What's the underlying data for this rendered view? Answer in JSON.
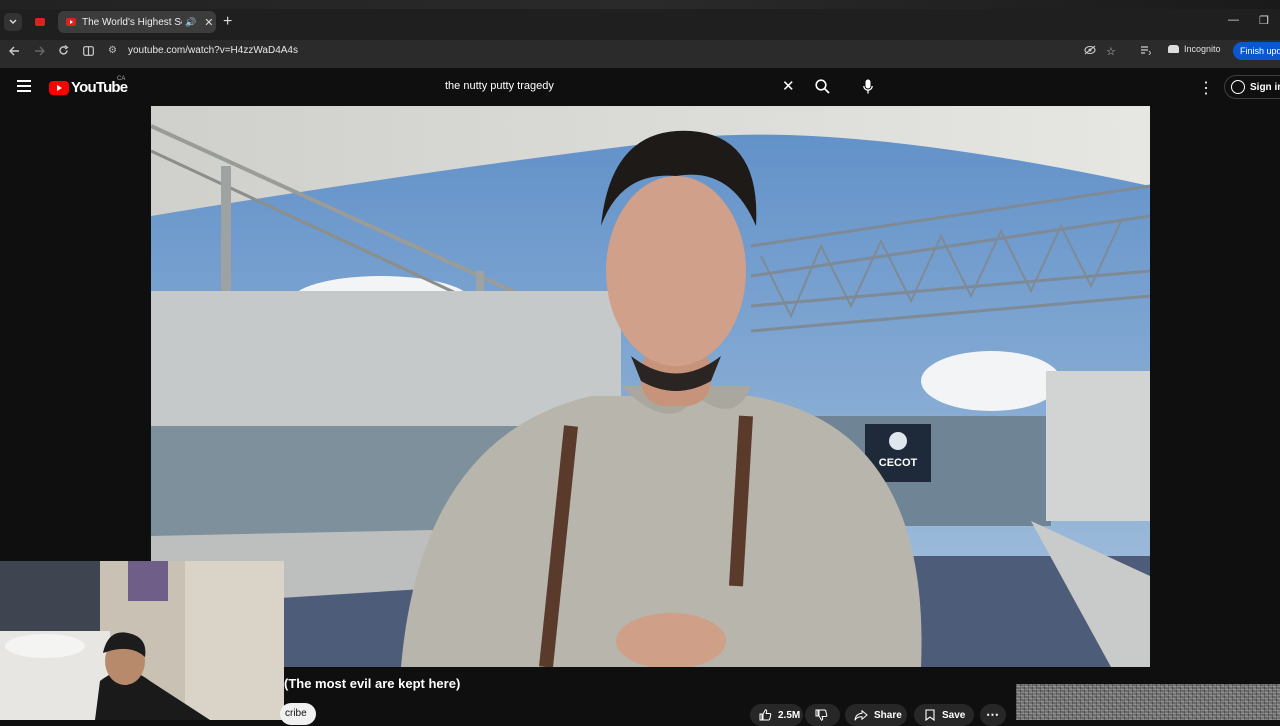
{
  "browser": {
    "tab_title": "The World's Highest Security Prison",
    "url": "youtube.com/watch?v=H4zzWaD4A4s",
    "incognito_label": "Incognito",
    "finish_update_label": "Finish update"
  },
  "youtube": {
    "logo_text": "YouTube",
    "country_code": "CA",
    "search_query": "the nutty putty tragedy",
    "sign_in_label": "Sign in"
  },
  "video": {
    "sign_text": "CECOT",
    "title_visible": "(The most evil are kept here)",
    "subscribe_partial": "cribe",
    "like_count": "2.5M",
    "share_label": "Share",
    "save_label": "Save"
  },
  "colors": {
    "yt_red": "#ff0000",
    "page_bg": "#0f0f0f",
    "button_bg": "#272727",
    "finish_btn": "#0b57d0"
  }
}
